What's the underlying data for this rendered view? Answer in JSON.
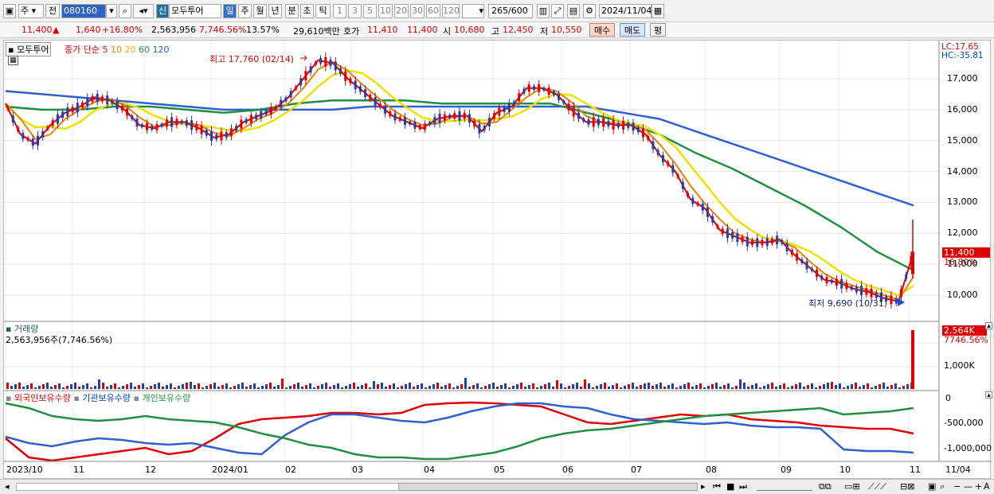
{
  "toolbar": {
    "type_value": "주",
    "type_prefix": "전",
    "code": "080160",
    "name_prefix": "신",
    "stock_name": "모두투어",
    "periods": [
      "일",
      "주",
      "월",
      "년",
      "분",
      "초",
      "틱"
    ],
    "intervals": [
      "1",
      "3",
      "5",
      "10",
      "20",
      "30",
      "60",
      "120"
    ],
    "count_value": "265",
    "count_max": "/600",
    "date": "2024/11/04"
  },
  "quote": {
    "price": "11,400",
    "change": "1,640",
    "change_pct": "+16.80%",
    "volume": "2,563,956",
    "volume_pct": "7,746.56%",
    "turnover": "13.57%",
    "amount": "29,610백만",
    "bid_label": "호가",
    "bid": "11,410",
    "ask": "11,400",
    "open_label": "시",
    "open": "10,680",
    "high_label": "고",
    "high": "12,450",
    "low_label": "저",
    "low": "10,550",
    "buy_button": "매수",
    "sell_button": "매도",
    "eval_button": "평"
  },
  "price_panel": {
    "title": "모두투어",
    "ma_label": "종가 단순",
    "ma_periods": [
      "5",
      "10",
      "20",
      "60",
      "120"
    ],
    "ma_colors": [
      "#e00000",
      "#f08000",
      "#f0e000",
      "#209040",
      "#3060d0"
    ],
    "lc": "LC:17.65",
    "hc": "HC:-35.81",
    "current_price": "11,400",
    "current_pct": "16.80%",
    "high_note": "최고 17,760 (02/14)",
    "low_note": "최저 9,690 (10/31)",
    "y_ticks": [
      "17,000",
      "16,000",
      "15,000",
      "14,000",
      "13,000",
      "12,000",
      "11,000",
      "10,000"
    ]
  },
  "volume_panel": {
    "title": "거래량",
    "value": "2,563,956주(7,746.56%)",
    "current": "2,564K",
    "current_pct": "7746.56%",
    "y_ticks": [
      "1,000K"
    ]
  },
  "holding_panel": {
    "series": [
      "외국인보유수량",
      "기관보유수량",
      "개인보유수량"
    ],
    "colors": [
      "#e00000",
      "#3060d0",
      "#209040"
    ],
    "y_ticks": [
      "0",
      "-500,000",
      "-1,000,000"
    ]
  },
  "x_axis": [
    "2023/10",
    "11",
    "12",
    "2024/01",
    "02",
    "03",
    "04",
    "05",
    "06",
    "07",
    "08",
    "09",
    "10",
    "11"
  ],
  "x_right": "11/04",
  "chart_data": [
    {
      "type": "line",
      "title": "모두투어",
      "series": [
        {
          "name": "종가",
          "values": [
            16.2,
            15.2,
            14.9,
            15.5,
            15.9,
            16.1,
            16.4,
            16.3,
            16.0,
            15.5,
            15.4,
            15.6,
            15.6,
            15.4,
            15.1,
            15.2,
            15.6,
            15.8,
            16.0,
            16.4,
            17.0,
            17.6,
            17.5,
            17.0,
            16.6,
            16.2,
            15.8,
            15.6,
            15.4,
            15.7,
            15.8,
            15.8,
            15.3,
            15.9,
            16.1,
            16.7,
            16.7,
            16.5,
            16.0,
            15.6,
            15.6,
            15.5,
            15.5,
            15.2,
            14.5,
            14.0,
            13.1,
            12.8,
            12.1,
            11.9,
            11.7,
            11.7,
            11.8,
            11.3,
            10.9,
            10.5,
            10.4,
            10.2,
            10.1,
            9.9,
            9.8,
            11.4
          ]
        },
        {
          "name": "120",
          "values": [
            16.6,
            16.5,
            16.4,
            16.3,
            16.2,
            16.1,
            16.0,
            16.0,
            16.0,
            16.0,
            16.1,
            16.1,
            16.1,
            16.1,
            16.1,
            16.1,
            16.1,
            15.9,
            15.7,
            15.3,
            14.9,
            14.5,
            14.1,
            13.7,
            13.3,
            12.9
          ]
        },
        {
          "name": "60",
          "values": [
            16.1,
            16.0,
            16.0,
            16.1,
            16.1,
            16.0,
            15.9,
            16.0,
            16.2,
            16.3,
            16.3,
            16.3,
            16.2,
            16.2,
            16.2,
            16.2,
            15.9,
            15.6,
            15.2,
            14.6,
            14.1,
            13.5,
            12.9,
            12.2,
            11.4,
            10.8
          ]
        }
      ]
    },
    {
      "type": "bar",
      "title": "거래량",
      "values": [
        2563956
      ]
    }
  ]
}
